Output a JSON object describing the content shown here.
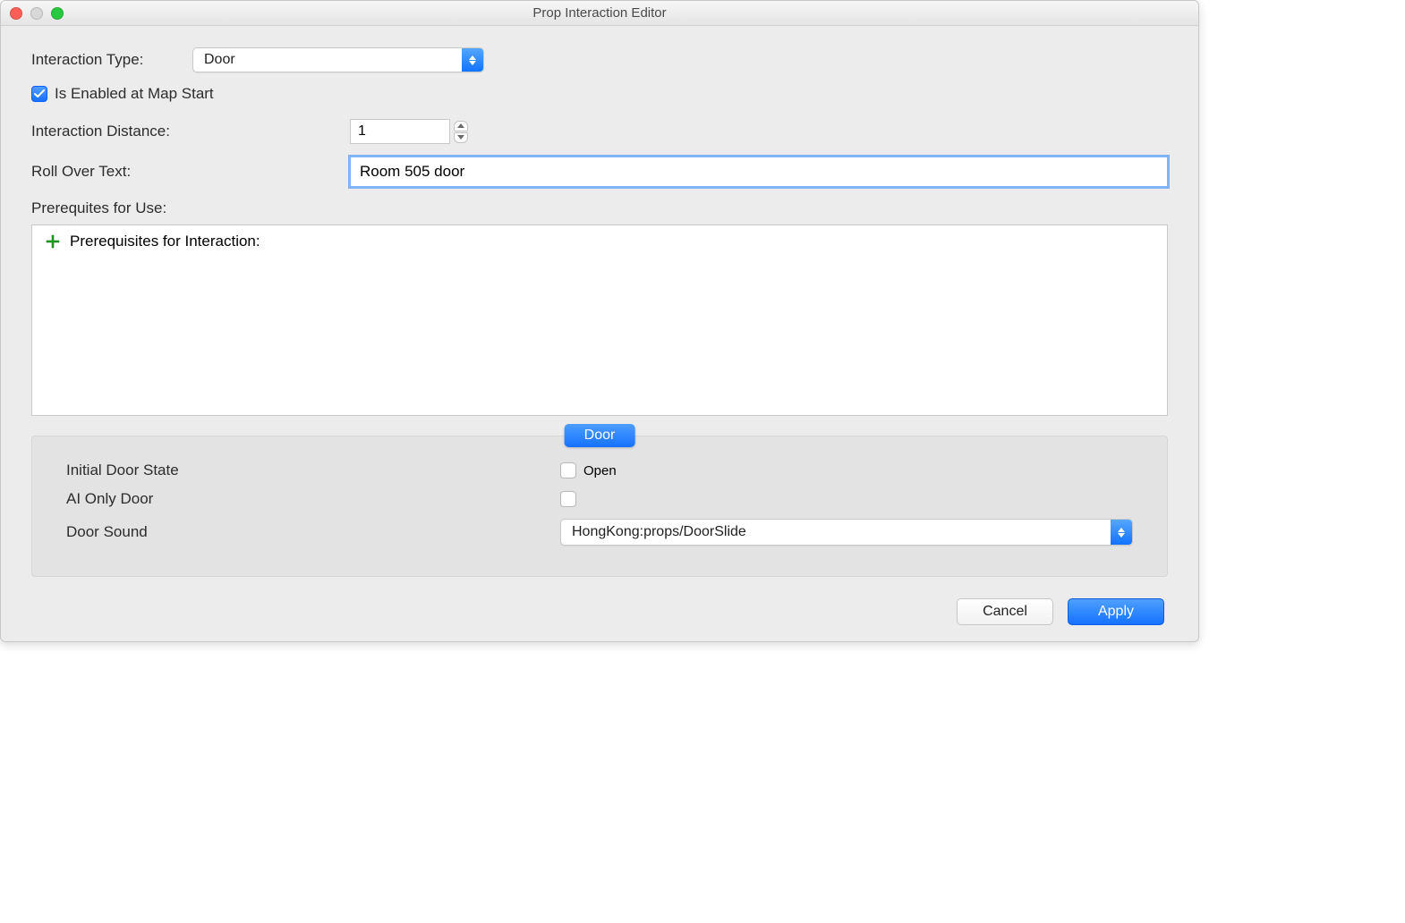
{
  "window": {
    "title": "Prop Interaction Editor"
  },
  "form": {
    "interaction_type_label": "Interaction Type:",
    "interaction_type_value": "Door",
    "enabled_label": "Is Enabled at Map Start",
    "enabled_checked": true,
    "distance_label": "Interaction Distance:",
    "distance_value": "1",
    "rollover_label": "Roll Over Text:",
    "rollover_value": "Room 505 door",
    "prereq_label": "Prerequites for Use:",
    "prereq_box_header": "Prerequisites for Interaction:"
  },
  "door": {
    "tab_label": "Door",
    "initial_state_label": "Initial Door State",
    "initial_state_value_label": "Open",
    "initial_state_checked": false,
    "ai_only_label": "AI Only Door",
    "ai_only_checked": false,
    "sound_label": "Door Sound",
    "sound_value": "HongKong:props/DoorSlide"
  },
  "footer": {
    "cancel": "Cancel",
    "apply": "Apply"
  }
}
